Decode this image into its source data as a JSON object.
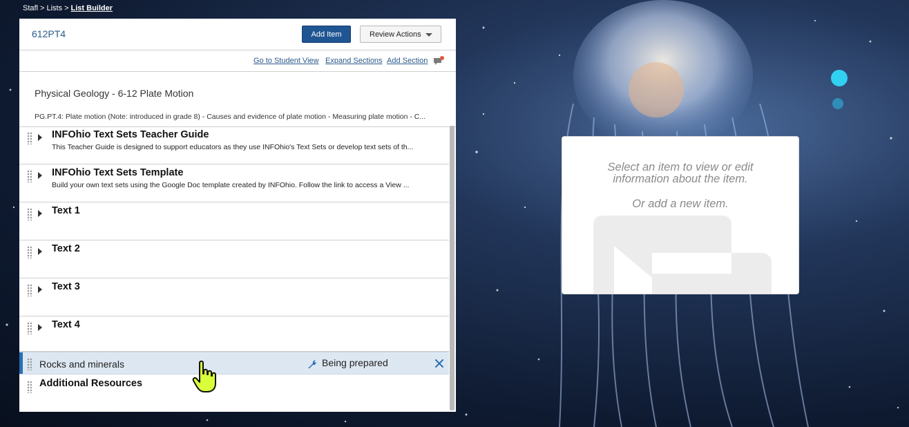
{
  "breadcrumb": {
    "items": [
      "Stafl",
      "Lists",
      "List Builder"
    ],
    "separator": ">"
  },
  "header": {
    "list_code": "612PT4",
    "add_item_label": "Add Item",
    "review_actions_label": "Review Actions"
  },
  "links": {
    "student_view": "Go to Student View",
    "expand_sections": "Expand Sections",
    "add_section": "Add Section"
  },
  "section": {
    "title": "Physical Geology - 6-12 Plate Motion",
    "description": "PG.PT.4: Plate motion (Note: introduced in grade 8) - Causes and evidence of plate motion - Measuring plate motion - C..."
  },
  "items": [
    {
      "title": "INFOhio Text Sets Teacher Guide",
      "desc": "This Teacher Guide is designed to support educators as they use INFOhio's Text Sets or develop text sets of th..."
    },
    {
      "title": "INFOhio Text Sets Template",
      "desc": "Build your own text sets using the Google Doc template created by INFOhio. Follow the link to access a View ..."
    },
    {
      "title": "Text 1",
      "desc": ""
    },
    {
      "title": "Text 2",
      "desc": ""
    },
    {
      "title": "Text 3",
      "desc": ""
    },
    {
      "title": "Text 4",
      "desc": ""
    }
  ],
  "preparing_item": {
    "title": "Rocks and minerals",
    "status": "Being prepared"
  },
  "additional": {
    "title": "Additional Resources"
  },
  "info_panel": {
    "line1": "Select an item to view or edit",
    "line2": "information about the item.",
    "line3": "Or add a new item."
  },
  "colors": {
    "primary_button": "#1f5592",
    "link": "#2b5a8a",
    "highlight_row": "#dde7f2",
    "cursor": "#d8ff3a"
  }
}
